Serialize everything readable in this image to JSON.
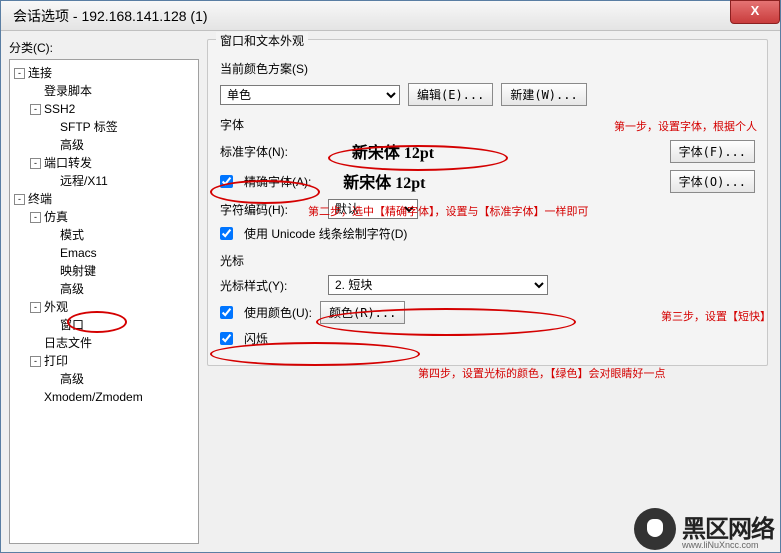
{
  "window": {
    "title": "会话选项 - 192.168.141.128 (1)",
    "close": "X"
  },
  "category_label": "分类(C):",
  "tree": {
    "n0": "连接",
    "n0_0": "登录脚本",
    "n0_1": "SSH2",
    "n0_1_0": "SFTP 标签",
    "n0_1_1": "高级",
    "n0_2": "端口转发",
    "n0_2_0": "远程/X11",
    "n1": "终端",
    "n1_0": "仿真",
    "n1_0_0": "模式",
    "n1_0_1": "Emacs",
    "n1_0_2": "映射键",
    "n1_0_3": "高级",
    "n1_1": "外观",
    "n1_1_0": "窗口",
    "n1_2": "日志文件",
    "n1_3": "打印",
    "n1_3_0": "高级",
    "n1_4": "Xmodem/Zmodem"
  },
  "panel_title": "窗口和文本外观",
  "scheme": {
    "label": "当前颜色方案(S)",
    "value": "单色",
    "edit": "编辑(E)...",
    "newbtn": "新建(W)..."
  },
  "font": {
    "section": "字体",
    "std_label": "标准字体(N):",
    "std_value": "新宋体 12pt",
    "std_btn": "字体(F)...",
    "precise_label": "精确字体(A):",
    "precise_value": "新宋体 12pt",
    "precise_btn": "字体(O)...",
    "enc_label": "字符编码(H):",
    "enc_value": "默认",
    "unicode": "使用 Unicode 线条绘制字符(D)"
  },
  "cursor": {
    "section": "光标",
    "style_label": "光标样式(Y):",
    "style_value": "2. 短块",
    "usecolor": "使用颜色(U):",
    "colorbtn": "颜色(R)...",
    "blink": "闪烁"
  },
  "annotations": {
    "a1": "第一步，设置字体，根据个人",
    "a2": "第二步，选中【精确字体】，设置与【标准字体】一样即可",
    "a3": "第三步，设置【短快】",
    "a4": "第四步，设置光标的颜色，【绿色】会对眼睛好一点"
  },
  "watermark": {
    "main": "黑区网络",
    "sub": "www.liNuXncc.com"
  }
}
